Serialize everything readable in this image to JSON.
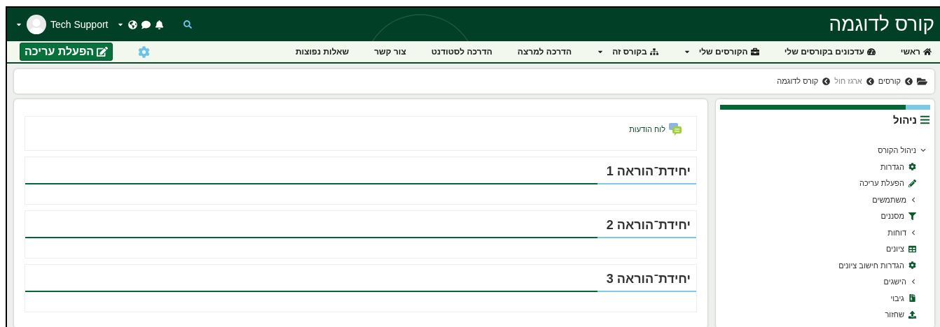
{
  "header": {
    "title": "קורס לדוגמה",
    "user": "Tech Support"
  },
  "nav": {
    "items": [
      {
        "label": "ראשי",
        "kind": "home",
        "dropdown": false
      },
      {
        "label": "עדכונים בקורסים שלי",
        "kind": "dashboard",
        "dropdown": false
      },
      {
        "label": "הקורסים שלי",
        "kind": "courses",
        "dropdown": true
      },
      {
        "label": "בקורס זה",
        "kind": "course",
        "dropdown": true
      },
      {
        "label": "הדרכה למרצה",
        "kind": "link",
        "dropdown": false
      },
      {
        "label": "הדרכה לסטודנט",
        "kind": "link",
        "dropdown": false
      },
      {
        "label": "צור קשר",
        "kind": "link",
        "dropdown": false
      },
      {
        "label": "שאלות נפוצות",
        "kind": "link",
        "dropdown": false
      }
    ],
    "edit_button": "הפעלת עריכה"
  },
  "breadcrumb": [
    {
      "label": "קורסים",
      "muted": false
    },
    {
      "label": "ארגז חול",
      "muted": true
    },
    {
      "label": "קורס לדוגמה",
      "muted": false
    }
  ],
  "sidebar": {
    "title": "ניהול",
    "tree": [
      {
        "label": "ניהול הקורס",
        "kind": "branch",
        "expanded": true,
        "children": [
          {
            "label": "הגדרות",
            "kind": "settings"
          },
          {
            "label": "הפעלת עריכה",
            "kind": "edit"
          },
          {
            "label": "משתמשים",
            "kind": "branch",
            "expanded": false
          },
          {
            "label": "מסננים",
            "kind": "filter"
          },
          {
            "label": "דוחות",
            "kind": "branch",
            "expanded": false
          },
          {
            "label": "ציונים",
            "kind": "grades"
          },
          {
            "label": "הגדרות חישוב ציונים",
            "kind": "settings"
          },
          {
            "label": "הישגים",
            "kind": "branch",
            "expanded": false
          },
          {
            "label": "גיבוי",
            "kind": "backup"
          },
          {
            "label": "שחזור",
            "kind": "restore"
          }
        ]
      }
    ]
  },
  "main": {
    "announcement": "לוח הודעות",
    "sections": [
      "יחידת־הוראה 1",
      "יחידת־הוראה 2",
      "יחידת־הוראה 3"
    ]
  }
}
